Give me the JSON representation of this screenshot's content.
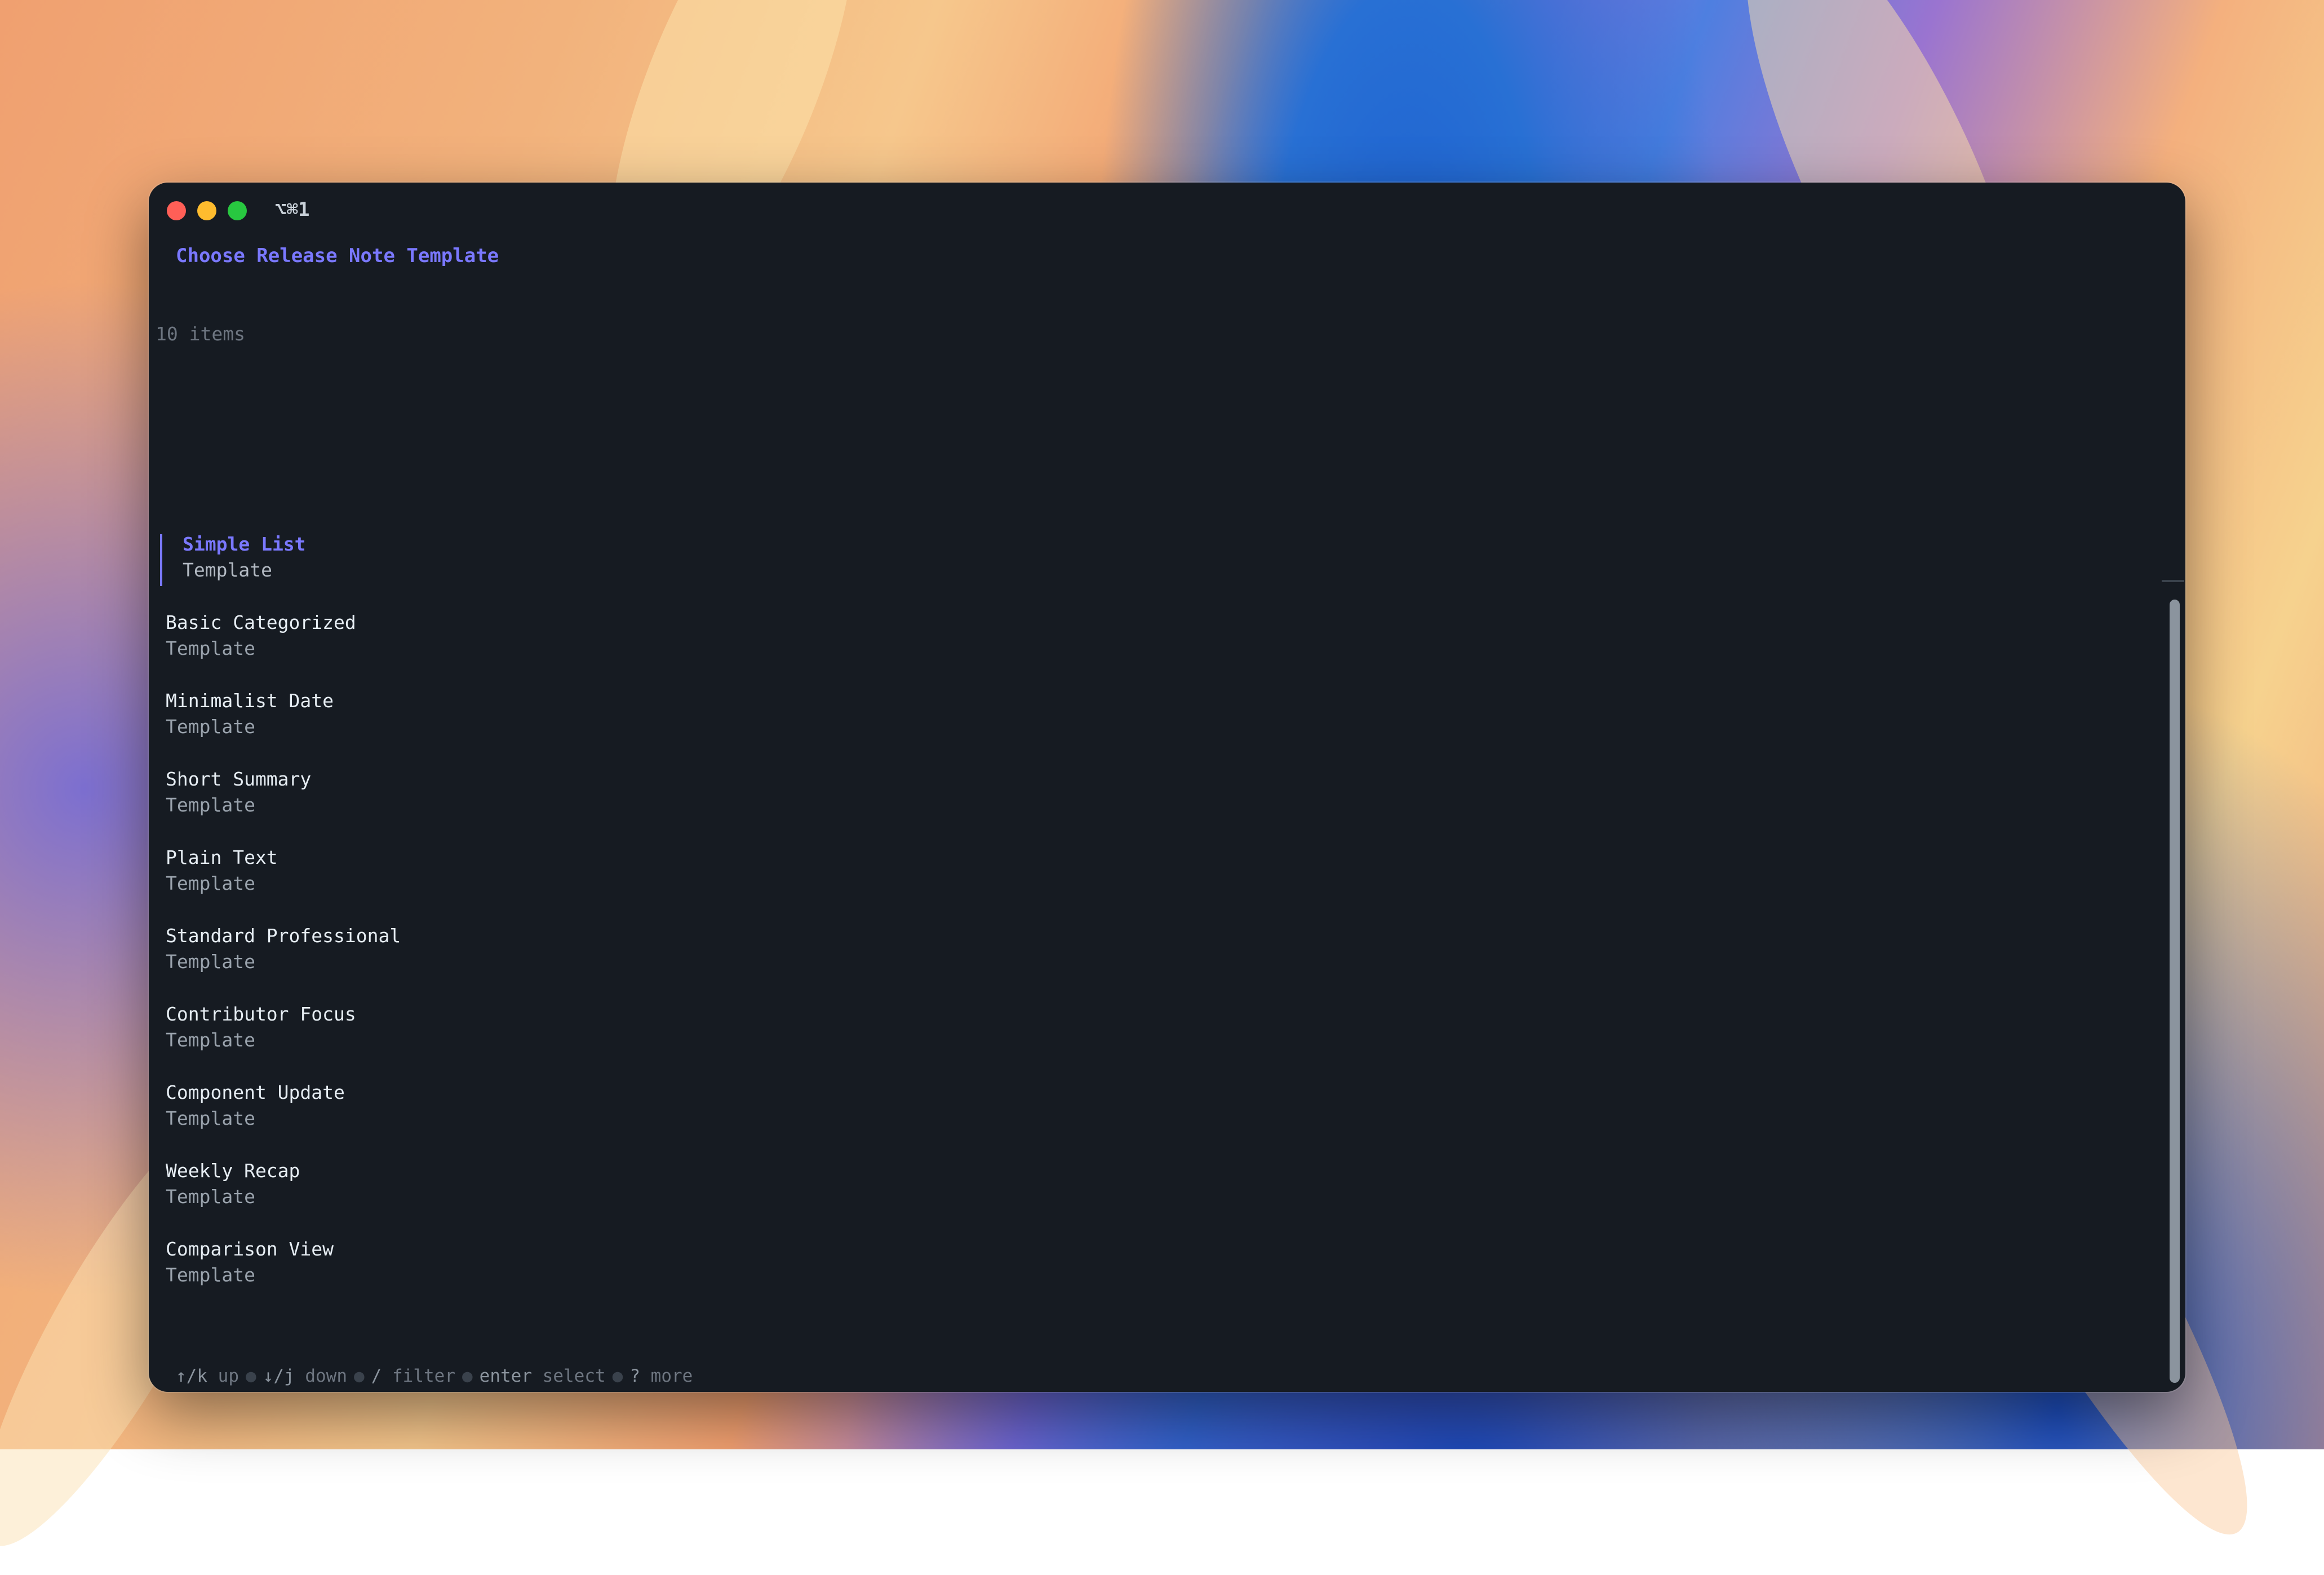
{
  "window": {
    "shortcut": "⌥⌘1",
    "colors": {
      "accent": "#7a78ff",
      "background": "#161b22",
      "close": "#ff5f57",
      "minimize": "#febc2e",
      "zoom": "#28c840"
    }
  },
  "prompt": {
    "title": "Choose Release Note Template",
    "count_label": "10 items"
  },
  "items": [
    {
      "title": "Simple List",
      "description": "Template",
      "selected": true
    },
    {
      "title": "Basic Categorized",
      "description": "Template",
      "selected": false
    },
    {
      "title": "Minimalist Date",
      "description": "Template",
      "selected": false
    },
    {
      "title": "Short Summary",
      "description": "Template",
      "selected": false
    },
    {
      "title": "Plain Text",
      "description": "Template",
      "selected": false
    },
    {
      "title": "Standard Professional",
      "description": "Template",
      "selected": false
    },
    {
      "title": "Contributor Focus",
      "description": "Template",
      "selected": false
    },
    {
      "title": "Component Update",
      "description": "Template",
      "selected": false
    },
    {
      "title": "Weekly Recap",
      "description": "Template",
      "selected": false
    },
    {
      "title": "Comparison View",
      "description": "Template",
      "selected": false
    }
  ],
  "help": {
    "up_key": "↑/k",
    "up_label": "up",
    "down_key": "↓/j",
    "down_label": "down",
    "filter_key": "/",
    "filter_label": "filter",
    "select_key": "enter",
    "select_label": "select",
    "more_key": "?",
    "more_label": "more"
  }
}
